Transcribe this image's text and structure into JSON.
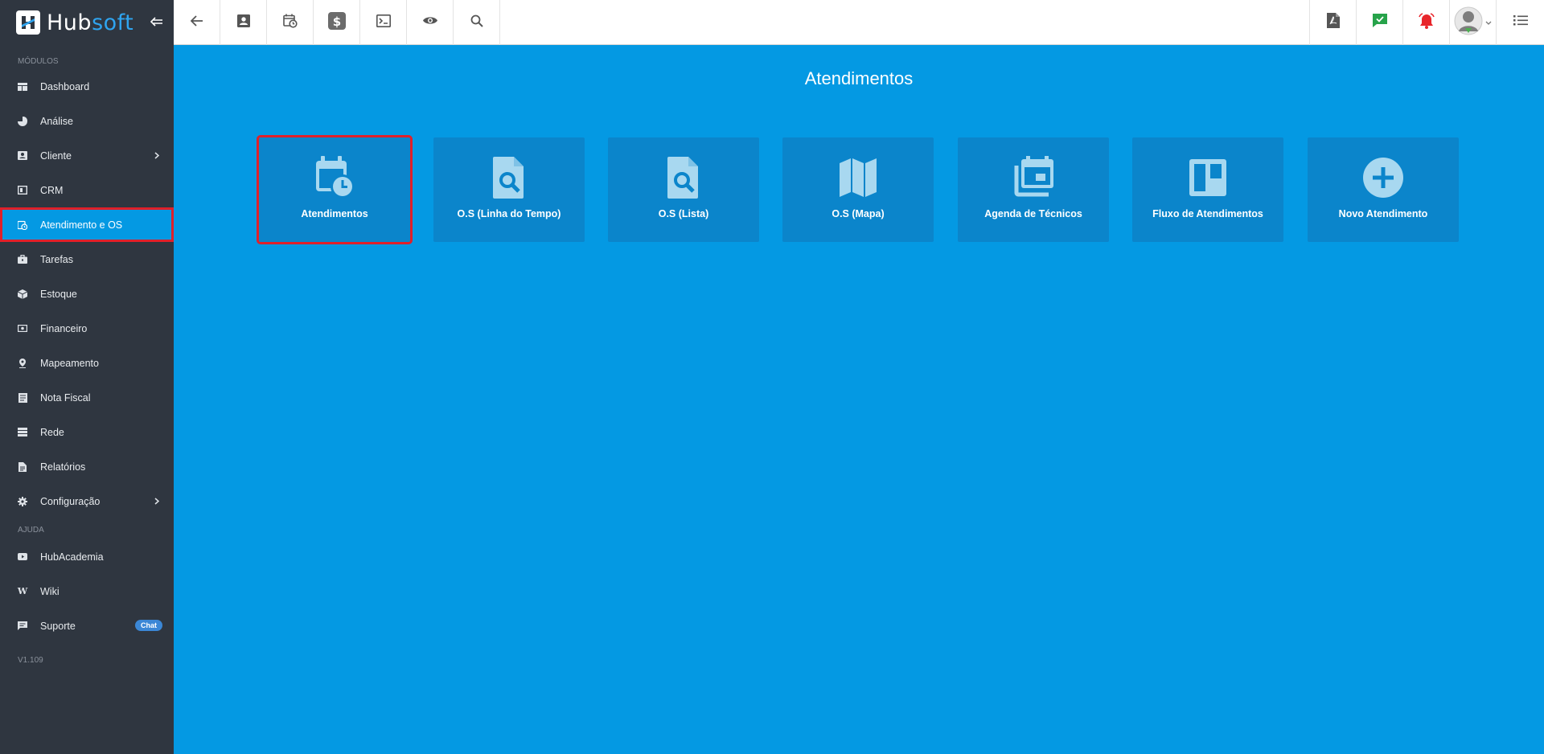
{
  "brand": {
    "hub": "Hub",
    "soft": "soft"
  },
  "sidebar": {
    "section_modulos": "MÓDULOS",
    "items": [
      {
        "label": "Dashboard",
        "icon": "dashboard-icon"
      },
      {
        "label": "Análise",
        "icon": "pie-chart-icon"
      },
      {
        "label": "Cliente",
        "icon": "contact-card-icon",
        "has_submenu": true
      },
      {
        "label": "CRM",
        "icon": "crm-board-icon"
      },
      {
        "label": "Atendimento e OS",
        "icon": "calendar-clock-icon",
        "active": true
      },
      {
        "label": "Tarefas",
        "icon": "briefcase-icon"
      },
      {
        "label": "Estoque",
        "icon": "box-icon"
      },
      {
        "label": "Financeiro",
        "icon": "money-icon"
      },
      {
        "label": "Mapeamento",
        "icon": "map-pin-icon"
      },
      {
        "label": "Nota Fiscal",
        "icon": "receipt-icon"
      },
      {
        "label": "Rede",
        "icon": "server-icon"
      },
      {
        "label": "Relatórios",
        "icon": "document-icon"
      },
      {
        "label": "Configuração",
        "icon": "gear-icon",
        "has_submenu": true
      }
    ],
    "section_ajuda": "AJUDA",
    "help_items": [
      {
        "label": "HubAcademia",
        "icon": "youtube-icon"
      },
      {
        "label": "Wiki",
        "icon": "wikipedia-icon"
      },
      {
        "label": "Suporte",
        "icon": "chat-icon",
        "badge": "Chat"
      }
    ],
    "version": "V1.109"
  },
  "topbar": {
    "left_buttons": [
      "back-arrow-icon",
      "contact-card-icon",
      "calendar-clock-icon",
      "dollar-icon",
      "terminal-icon",
      "eye-icon",
      "search-icon"
    ],
    "right_buttons": [
      "pdf-icon",
      "check-message-icon",
      "alarm-bell-icon",
      "user-avatar",
      "list-menu-icon"
    ]
  },
  "main": {
    "title": "Atendimentos",
    "tiles": [
      {
        "label": "Atendimentos",
        "icon": "calendar-clock-icon",
        "selected": true
      },
      {
        "label": "O.S (Linha do Tempo)",
        "icon": "file-search-icon"
      },
      {
        "label": "O.S (Lista)",
        "icon": "file-search-icon"
      },
      {
        "label": "O.S (Mapa)",
        "icon": "map-icon"
      },
      {
        "label": "Agenda de Técnicos",
        "icon": "calendar-stack-icon"
      },
      {
        "label": "Fluxo de Atendimentos",
        "icon": "kanban-board-icon"
      },
      {
        "label": "Novo Atendimento",
        "icon": "plus-circle-icon"
      }
    ]
  },
  "colors": {
    "sidebar_bg": "#2f3640",
    "accent": "#0499e3",
    "tile_bg": "#0b85cb",
    "highlight": "#e0202a",
    "notification_green": "#27a34a",
    "notification_red": "#e8262b"
  }
}
